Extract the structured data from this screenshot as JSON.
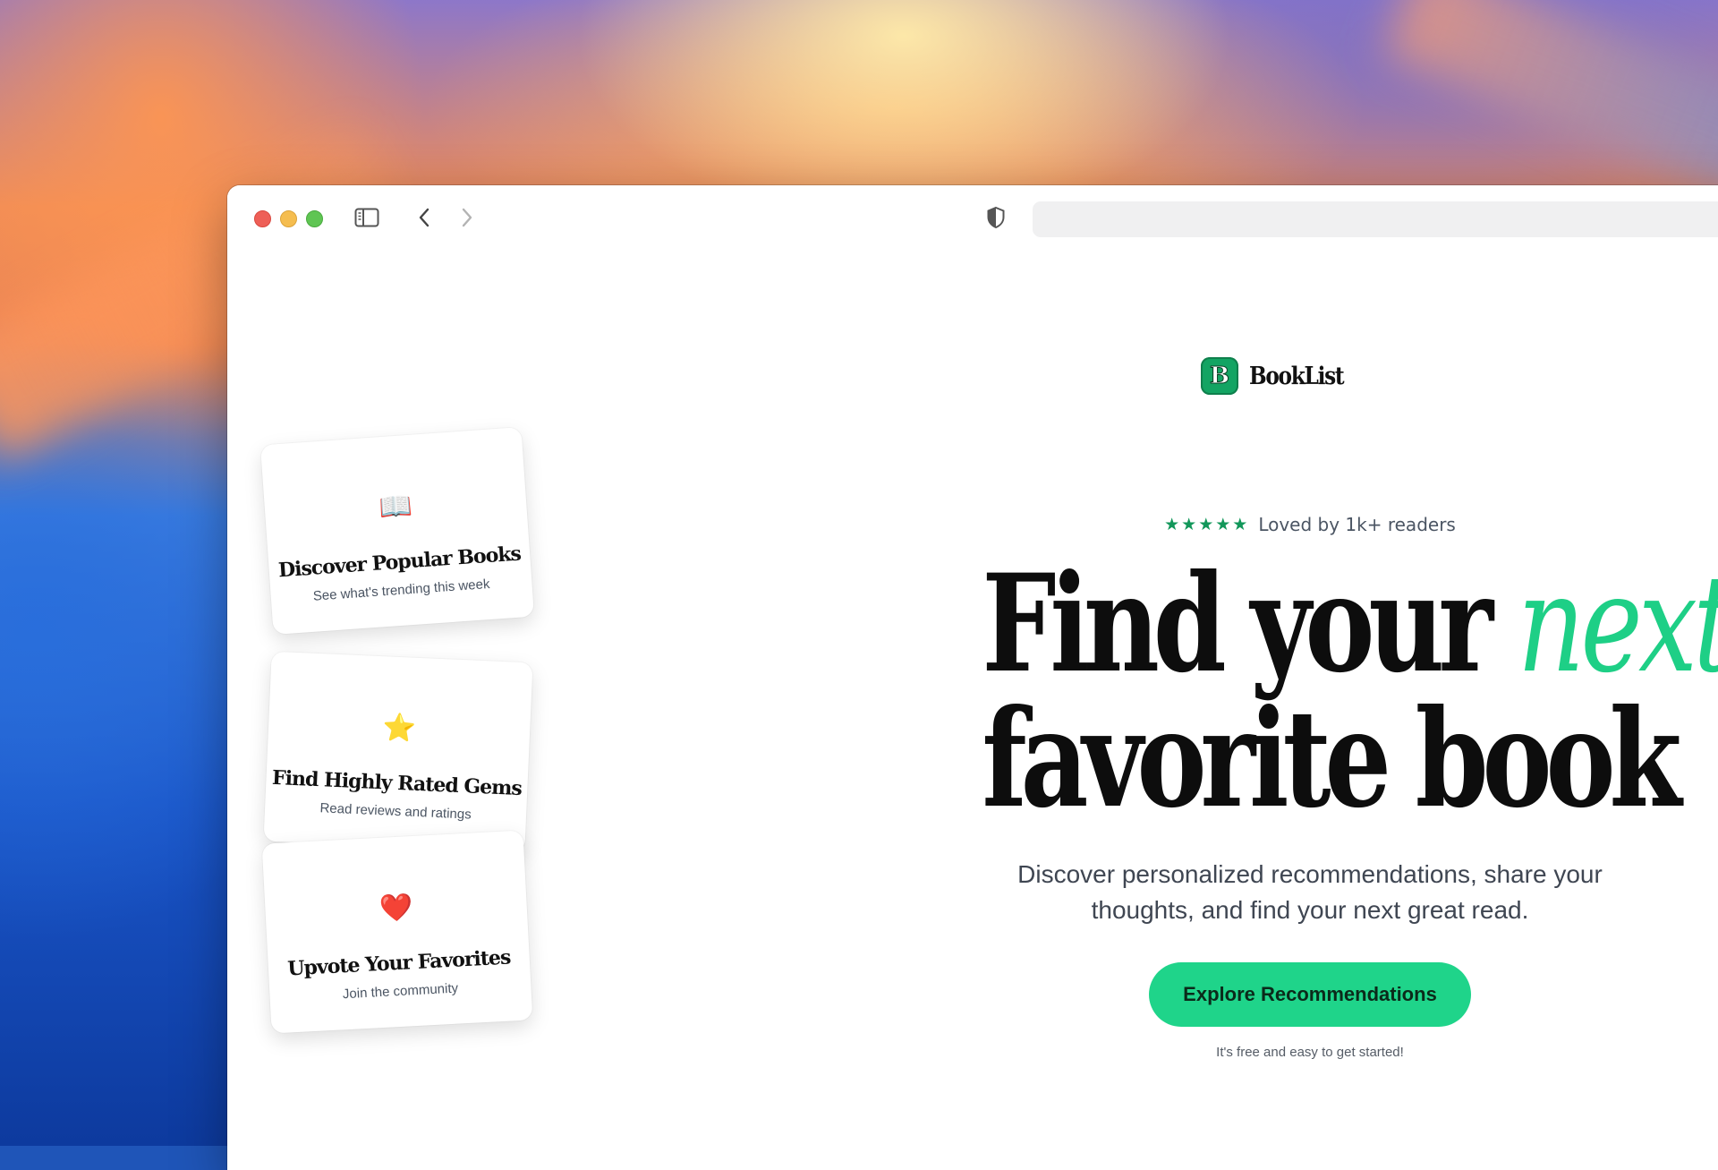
{
  "browser": {
    "toolbar": {
      "sidebar_icon": "sidebar-icon",
      "back_icon": "chevron-left-icon",
      "forward_icon": "chevron-right-icon",
      "privacy_icon": "shield-icon",
      "address": ""
    }
  },
  "brand": {
    "logo_letter": "B",
    "name": "BookList",
    "color": "#13a463"
  },
  "hero": {
    "rating_stars": "★★★★★",
    "rating_text": "Loved by 1k+ readers",
    "headline_part1": "Find your ",
    "headline_accent": "next",
    "headline_part2": "favorite book",
    "accent_color": "#1ecf86",
    "subtext": "Discover personalized recommendations, share your thoughts, and find your next great read.",
    "cta_label": "Explore Recommendations",
    "cta_color": "#1fd48a",
    "fine_print": "It's free and easy to get started!"
  },
  "features": [
    {
      "icon": "📖",
      "icon_name": "open-book-icon",
      "title": "Discover Popular Books",
      "description": "See what's trending this week"
    },
    {
      "icon": "⭐",
      "icon_name": "star-icon",
      "title": "Find Highly Rated Gems",
      "description": "Read reviews and ratings"
    },
    {
      "icon": "❤️",
      "icon_name": "heart-icon",
      "title": "Upvote Your Favorites",
      "description": "Join the community"
    }
  ]
}
